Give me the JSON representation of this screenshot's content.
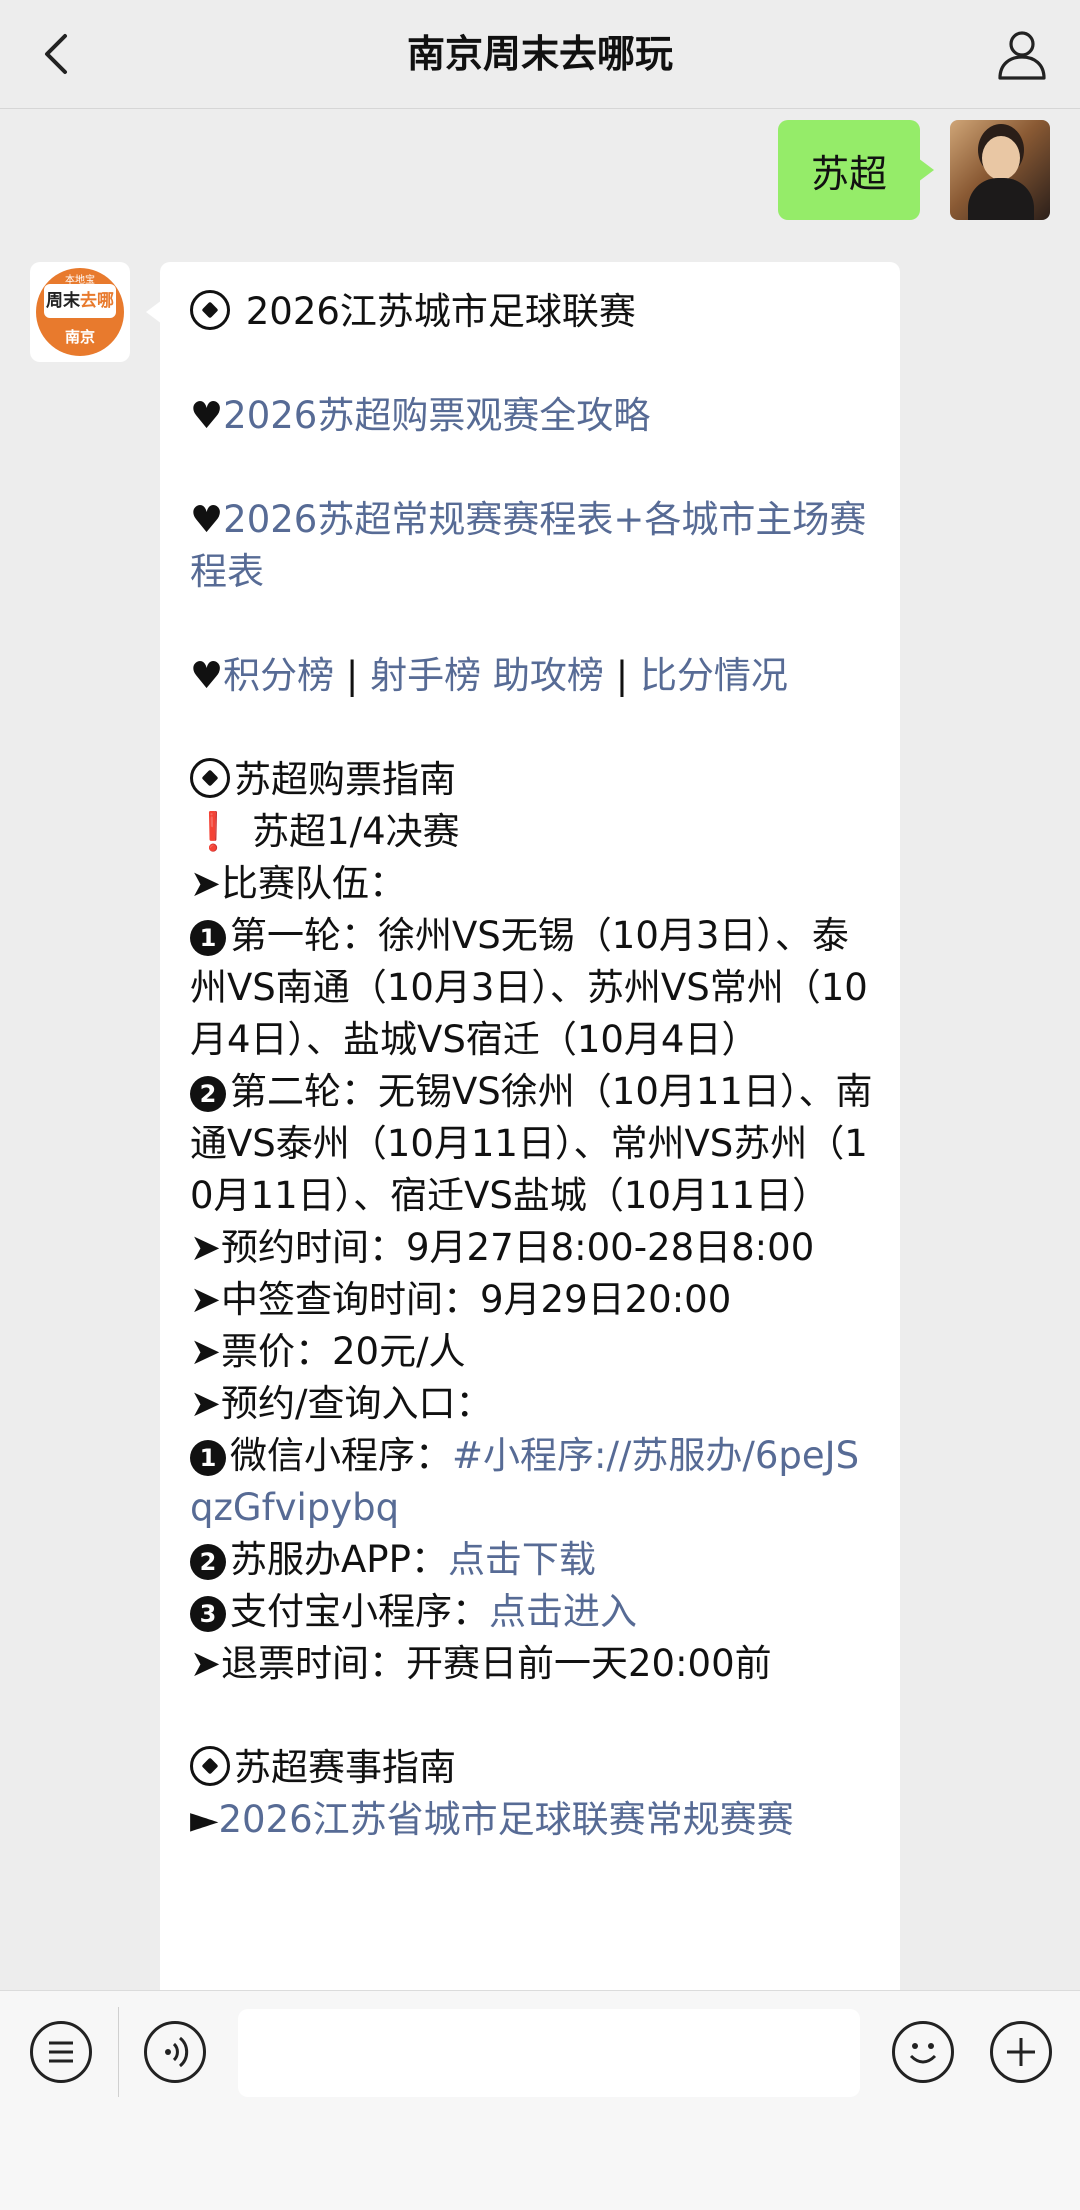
{
  "nav": {
    "title": "南京周末去哪玩"
  },
  "chat": {
    "user_message": "苏超",
    "bot_avatar": {
      "top_text": "本地宝",
      "main_text_a": "周末",
      "main_text_b": "去哪",
      "bottom_text": "南京"
    },
    "bot_message": {
      "title": "2026江苏城市足球联赛",
      "link1": "2026苏超购票观赛全攻略",
      "link2": "2026苏超常规赛赛程表+各城市主场赛程表",
      "links_row": {
        "a": "积分榜",
        "sep1": " | ",
        "b": "射手榜 助攻榜",
        "sep2": " | ",
        "c": "比分情况"
      },
      "guide_title": "苏超购票指南",
      "quarter_final": "苏超1/4决赛",
      "teams_label": "➤比赛队伍：",
      "round1_num": "1",
      "round1": "第一轮：徐州VS无锡（10月3日）、泰州VS南通（10月3日）、苏州VS常州（10月4日）、盐城VS宿迁（10月4日）",
      "round2_num": "2",
      "round2": "第二轮：无锡VS徐州（10月11日）、南通VS泰州（10月11日）、常州VS苏州（10月11日）、宿迁VS盐城（10月11日）",
      "reserve_time": "➤预约时间：9月27日8:00-28日8:00",
      "lottery_time": "➤中签查询时间：9月29日20:00",
      "price": "➤票价：20元/人",
      "entry_label": "➤预约/查询入口：",
      "entry1_num": "1",
      "entry1_label": "微信小程序：",
      "entry1_link": "#小程序://苏服办/6peJSqzGfvipybq",
      "entry2_num": "2",
      "entry2_label": "苏服办APP：",
      "entry2_link": "点击下载",
      "entry3_num": "3",
      "entry3_label": "支付宝小程序：",
      "entry3_link": "点击进入",
      "refund_time": "➤退票时间：开赛日前一天20:00前",
      "event_title": "苏超赛事指南",
      "event_link_prefix": "►",
      "event_link": "2026江苏省城市足球联赛常规赛赛"
    }
  }
}
